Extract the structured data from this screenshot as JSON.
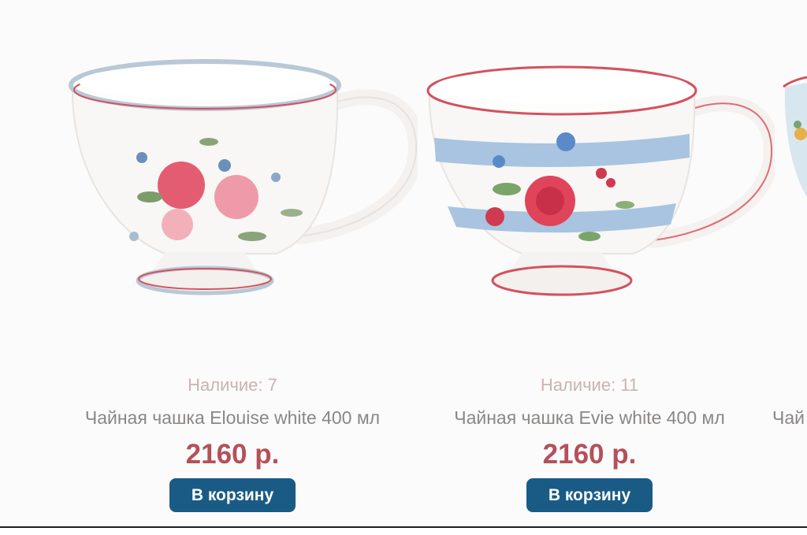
{
  "products": [
    {
      "stock_label": "Наличие: 7",
      "title": "Чайная чашка Elouise white 400 мл",
      "price": "2160 р.",
      "button": "В корзину"
    },
    {
      "stock_label": "Наличие: 11",
      "title": "Чайная чашка Evie white 400 мл",
      "price": "2160 р.",
      "button": "В корзину"
    },
    {
      "title": "Чай"
    }
  ],
  "colors": {
    "price": "#b4505a",
    "button_bg": "#1a5b85",
    "stock_text": "#c9b4b0",
    "title_text": "#8a8785"
  }
}
